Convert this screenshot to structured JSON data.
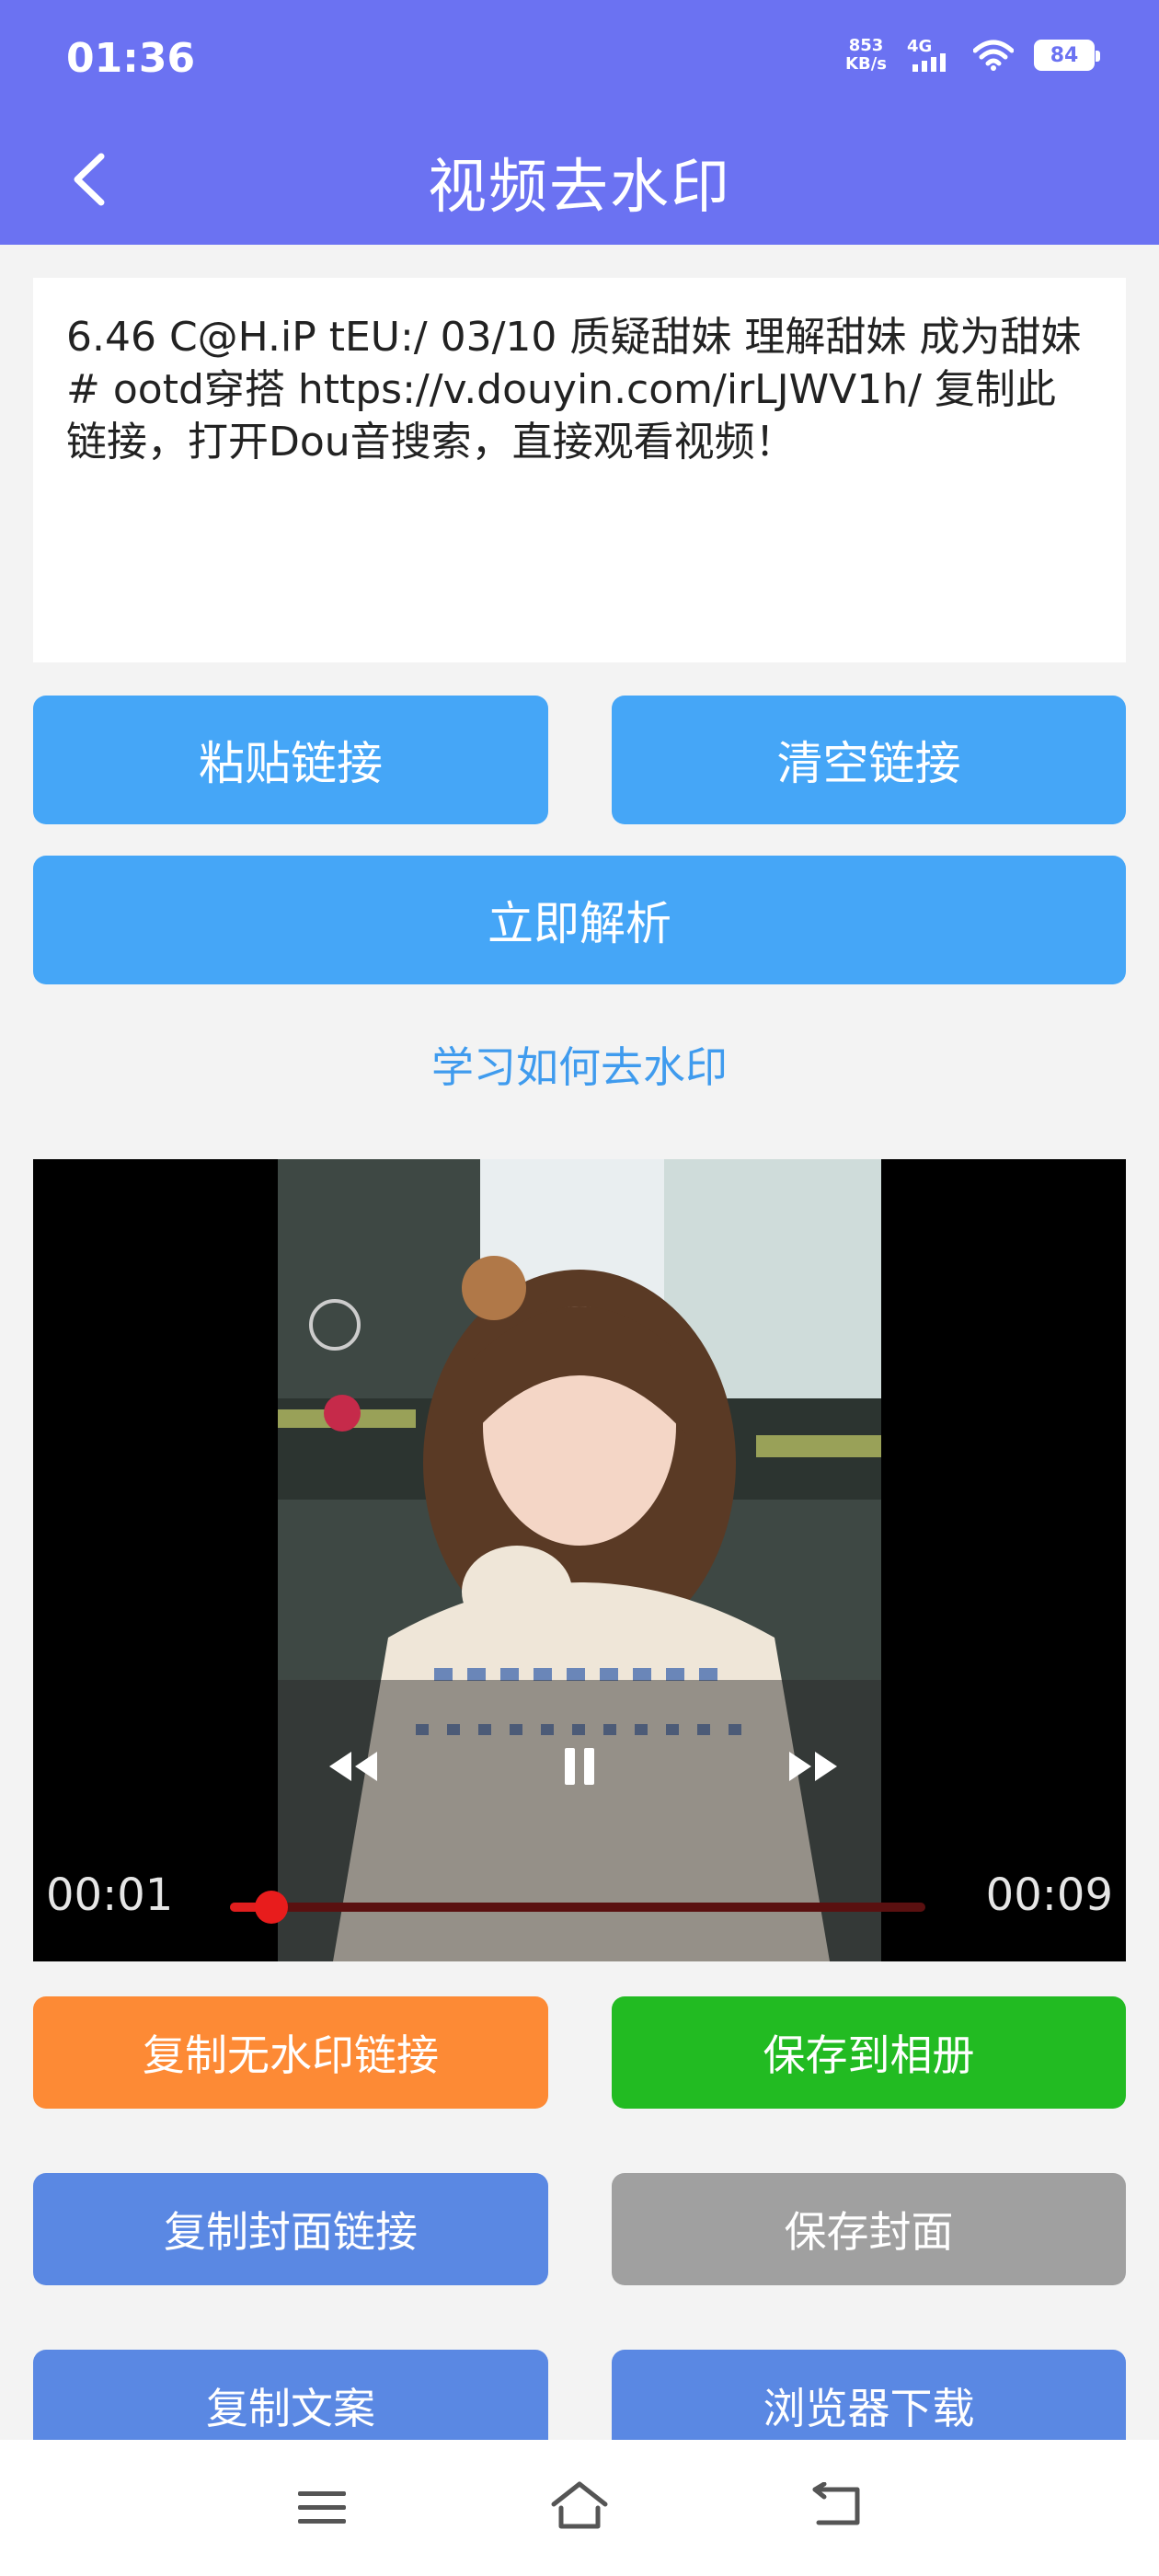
{
  "status_bar": {
    "time": "01:36",
    "net_speed_value": "853",
    "net_speed_unit": "KB/s",
    "network": "4G",
    "battery": "84"
  },
  "header": {
    "title": "视频去水印",
    "back_icon": "chevron-left-icon"
  },
  "link_input": {
    "value": "6.46 C@H.iP tEU:/ 03/10 质疑甜妹 理解甜妹 成为甜妹 # ootd穿搭 https://v.douyin.com/irLJWV1h/ 复制此链接，打开Dou音搜索，直接观看视频！"
  },
  "buttons": {
    "paste": "粘贴链接",
    "clear": "清空链接",
    "parse": "立即解析",
    "learn": "学习如何去水印"
  },
  "player": {
    "current_time": "00:01",
    "duration": "00:09",
    "progress": 0.06,
    "controls": [
      "rewind-icon",
      "pause-icon",
      "fast-forward-icon"
    ]
  },
  "actions": {
    "copy_nowm": "复制无水印链接",
    "save_album": "保存到相册",
    "copy_cover": "复制封面链接",
    "save_cover": "保存封面",
    "copy_text": "复制文案",
    "browser_download": "浏览器下载"
  },
  "colors": {
    "header": "#6b72f2",
    "primary_button": "#45a6f7",
    "orange": "#fd8a35",
    "green": "#22bb22",
    "blue": "#5a88e3",
    "gray": "#a0a0a0"
  },
  "nav": [
    "menu-icon",
    "home-icon",
    "back-icon"
  ]
}
